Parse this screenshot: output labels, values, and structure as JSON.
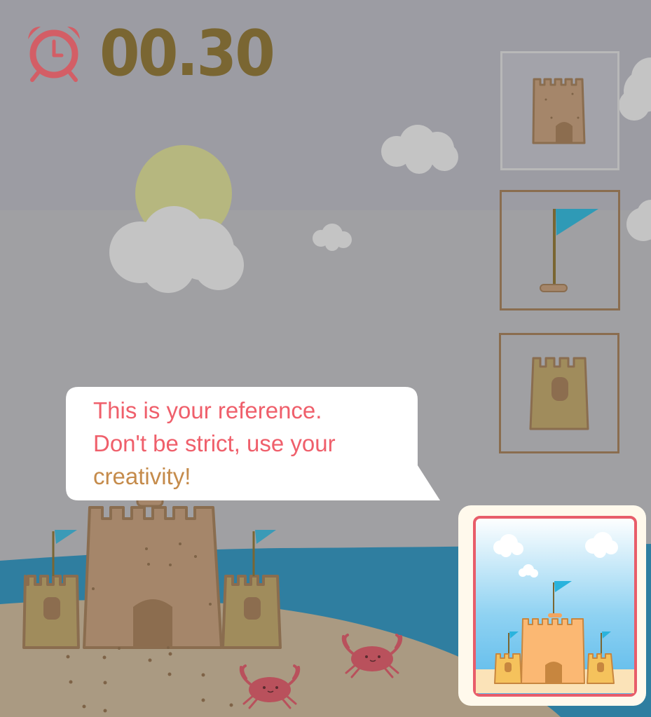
{
  "timer": {
    "icon": "alarm-clock-icon",
    "value": "00.30"
  },
  "tray": {
    "items": [
      {
        "name": "tower-piece",
        "icon": "wide-tower-icon",
        "selected": true
      },
      {
        "name": "flag-piece",
        "icon": "flag-icon",
        "selected": false
      },
      {
        "name": "turret-piece",
        "icon": "small-tower-icon",
        "selected": false
      }
    ]
  },
  "hint": {
    "line1": "This is your reference.",
    "line2": "Don't be strict, use your",
    "line3": "creativity!"
  },
  "reference": {
    "icon": "reference-castle-icon"
  },
  "colors": {
    "overlay": "#9a9aa3",
    "sand": "#aa9a82",
    "sea": "#2f7ea0",
    "timer_text": "#7a6632",
    "hint_red": "#ef5f6b",
    "hint_orange": "#c58b4b"
  }
}
